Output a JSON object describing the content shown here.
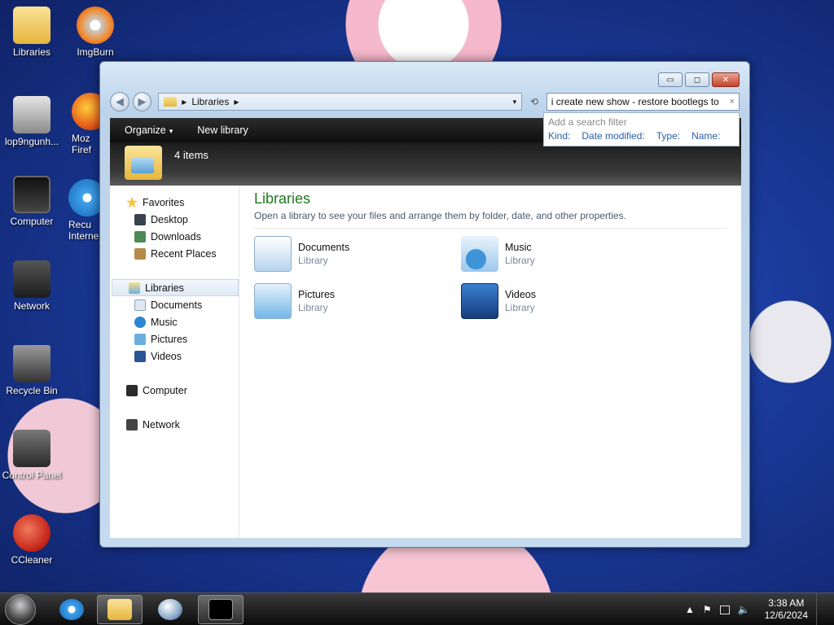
{
  "desktop": {
    "icons": [
      {
        "label": "Libraries",
        "color": "#f1cf6a"
      },
      {
        "label": "ImgBurn",
        "color": "#e0612a"
      },
      {
        "label": "lop9ngunh...",
        "color": "#9aa0a8"
      },
      {
        "label": "Moz Firef",
        "color": "#e86b1f"
      },
      {
        "label": "Computer",
        "color": "#2b2b2b"
      },
      {
        "label": "Recu Interne",
        "color": "#2f8ee0"
      },
      {
        "label": "Network",
        "color": "#3c3c3c"
      },
      {
        "label": "Recycle Bin",
        "color": "#5e5e5e"
      },
      {
        "label": "Control Panel",
        "color": "#4a4a4a"
      },
      {
        "label": "CCleaner",
        "color": "#d83a2b"
      }
    ]
  },
  "window": {
    "caption": {
      "minimize": "▭",
      "maximize": "◻",
      "close": "✕"
    },
    "nav": {
      "back": "◀",
      "forward": "▶"
    },
    "address": {
      "segment": "Libraries",
      "sep": "▸",
      "dropdown": "▾",
      "refresh": "⟲"
    },
    "search": {
      "value": "i create new show - restore bootlegs to",
      "clear": "×"
    },
    "filter": {
      "hint": "Add a search filter",
      "options": [
        "Kind:",
        "Date modified:",
        "Type:",
        "Name:"
      ]
    },
    "toolbar": {
      "organize": "Organize",
      "organize_arrow": "▾",
      "new_library": "New library"
    },
    "details": {
      "count": "4 items"
    },
    "navpane": {
      "favorites": "Favorites",
      "favorites_items": [
        "Desktop",
        "Downloads",
        "Recent Places"
      ],
      "libraries": "Libraries",
      "libraries_items": [
        "Documents",
        "Music",
        "Pictures",
        "Videos"
      ],
      "computer": "Computer",
      "network": "Network"
    },
    "content": {
      "title": "Libraries",
      "subtitle": "Open a library to see your files and arrange them by folder, date, and other properties.",
      "libraries": [
        {
          "name": "Documents",
          "type": "Library",
          "color": "#9fc6e8"
        },
        {
          "name": "Music",
          "type": "Library",
          "color": "#3e94d6"
        },
        {
          "name": "Pictures",
          "type": "Library",
          "color": "#74b7e6"
        },
        {
          "name": "Videos",
          "type": "Library",
          "color": "#2e6fbf"
        }
      ]
    }
  },
  "taskbar": {
    "clock_time": "3:38 AM",
    "clock_date": "12/6/2024",
    "tray_arrow": "▲",
    "flag": "⚑",
    "volume": "🔈"
  },
  "colors": {
    "accent_green": "#1e7a1e",
    "link_blue": "#2a5fa5"
  }
}
